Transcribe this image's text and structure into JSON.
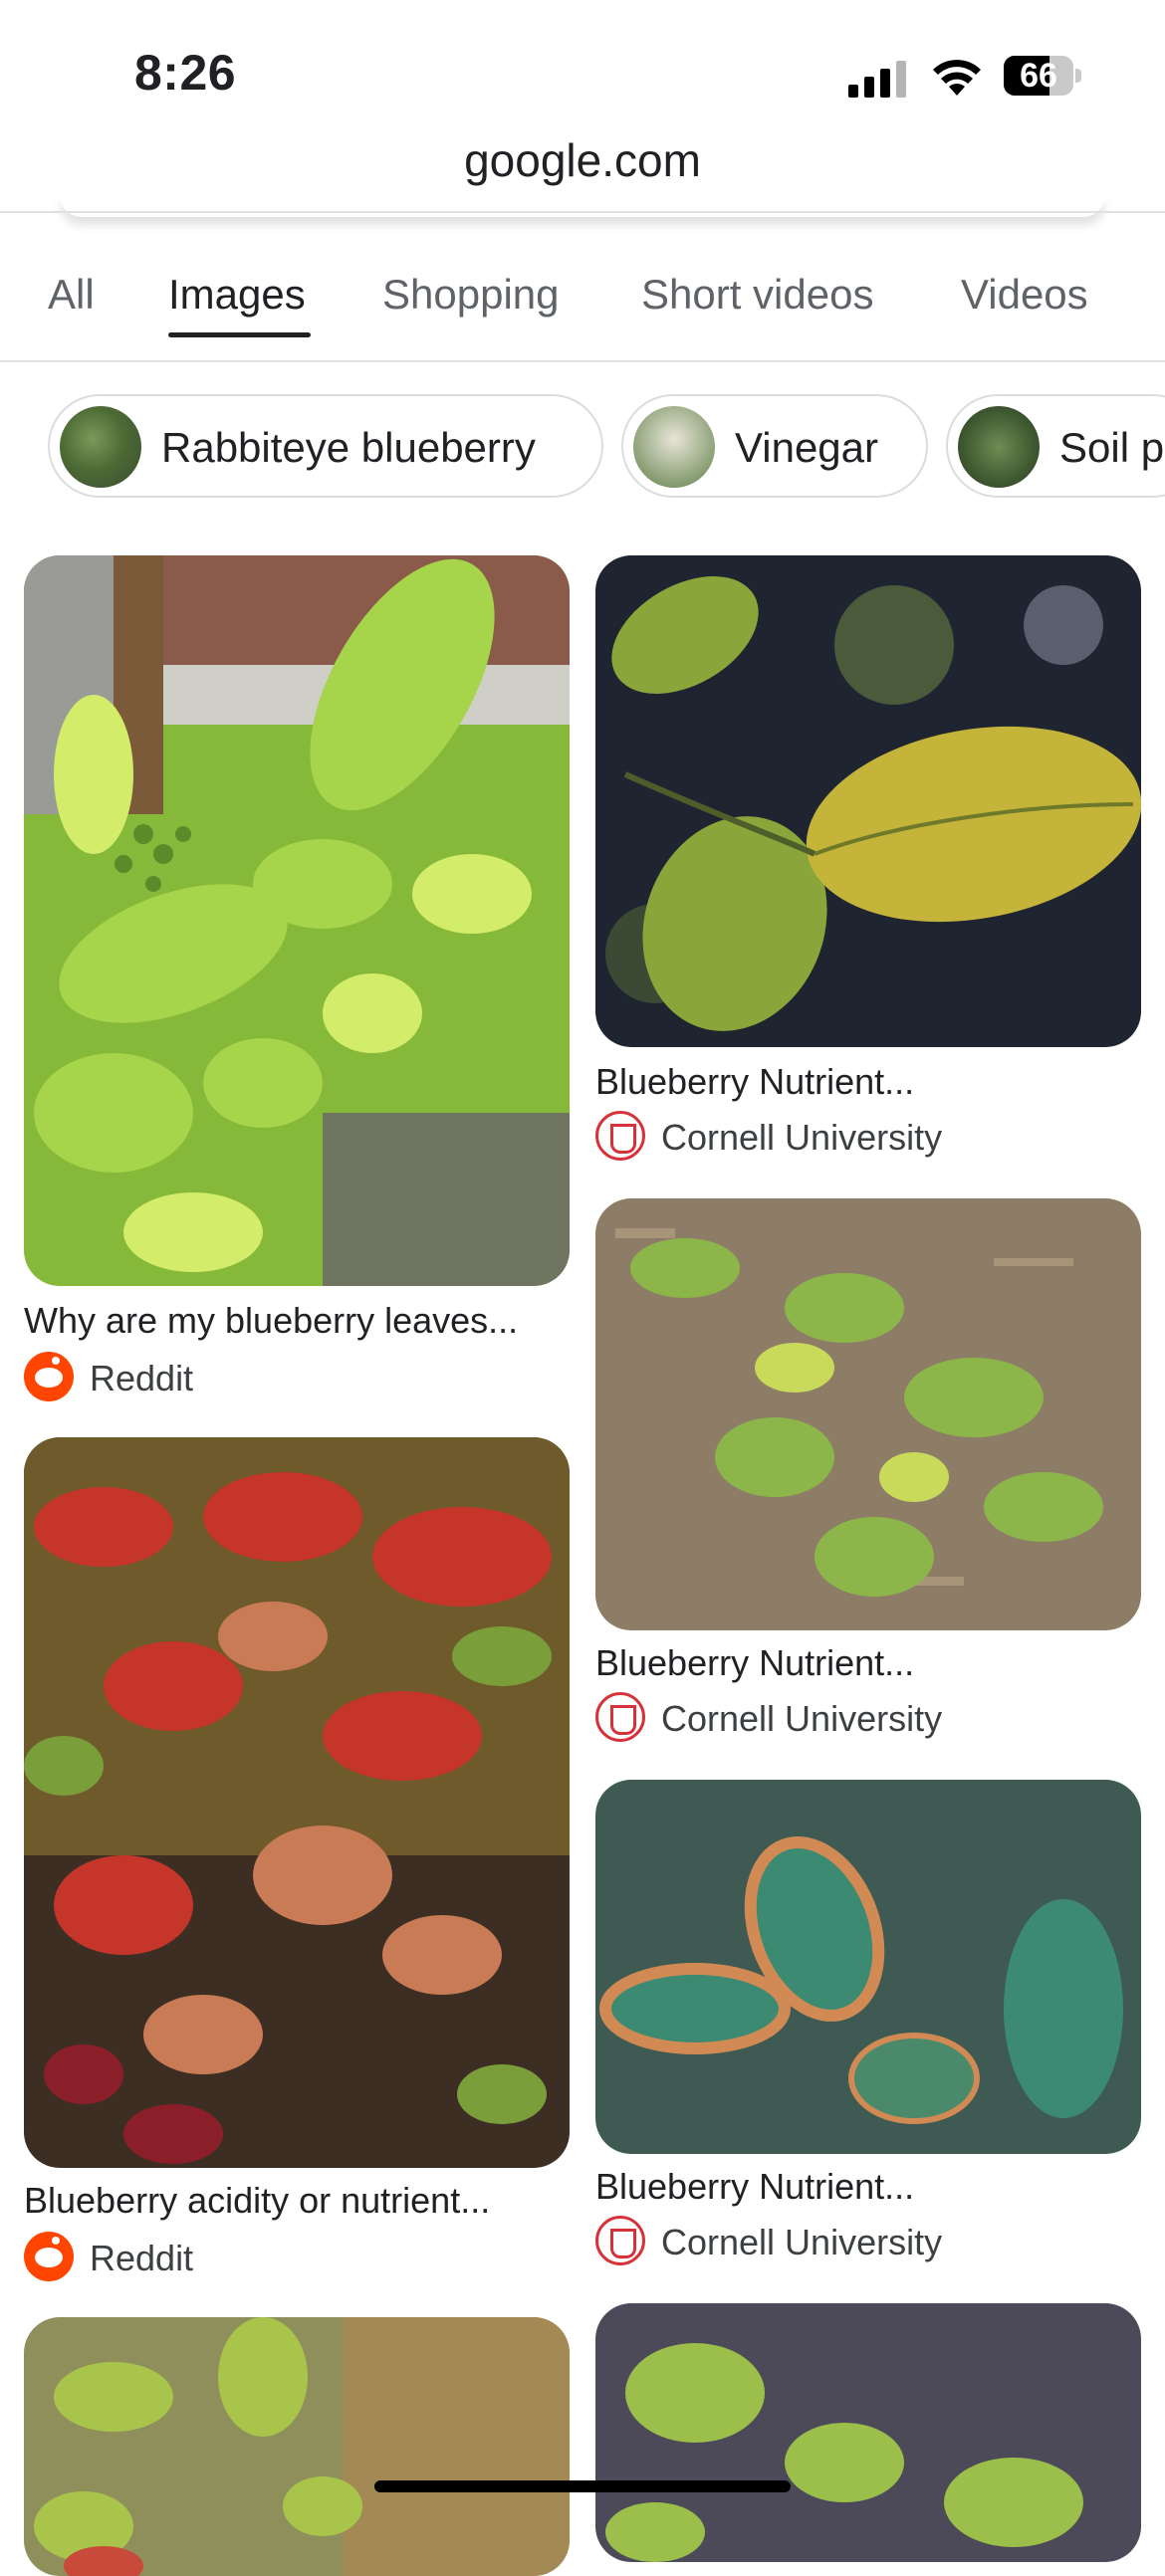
{
  "status_bar": {
    "time": "8:26",
    "battery": "66",
    "battery_level": 0.66
  },
  "browser": {
    "url": "google.com"
  },
  "tabs": [
    {
      "label": "All"
    },
    {
      "label": "Images",
      "active": true
    },
    {
      "label": "Shopping"
    },
    {
      "label": "Short videos"
    },
    {
      "label": "Videos"
    }
  ],
  "chips": [
    {
      "label": "Rabbiteye blueberry"
    },
    {
      "label": "Vinegar"
    },
    {
      "label": "Soil p"
    }
  ],
  "results": [
    {
      "title": "Why are my blueberry leaves...",
      "source": "Reddit",
      "source_icon": "reddit-icon"
    },
    {
      "title": "Blueberry Nutrient...",
      "source": "Cornell University",
      "source_icon": "cornell-shield-icon"
    },
    {
      "title": "Blueberry Nutrient...",
      "source": "Cornell University",
      "source_icon": "cornell-shield-icon"
    },
    {
      "title": "Blueberry acidity or nutrient...",
      "source": "Reddit",
      "source_icon": "reddit-icon"
    },
    {
      "title": "Blueberry Nutrient...",
      "source": "Cornell University",
      "source_icon": "cornell-shield-icon"
    }
  ],
  "colors": {
    "reddit": "#ff4500",
    "cornell": "#d6323a",
    "active_tab": "#202124",
    "inactive_tab": "#5f6368"
  }
}
